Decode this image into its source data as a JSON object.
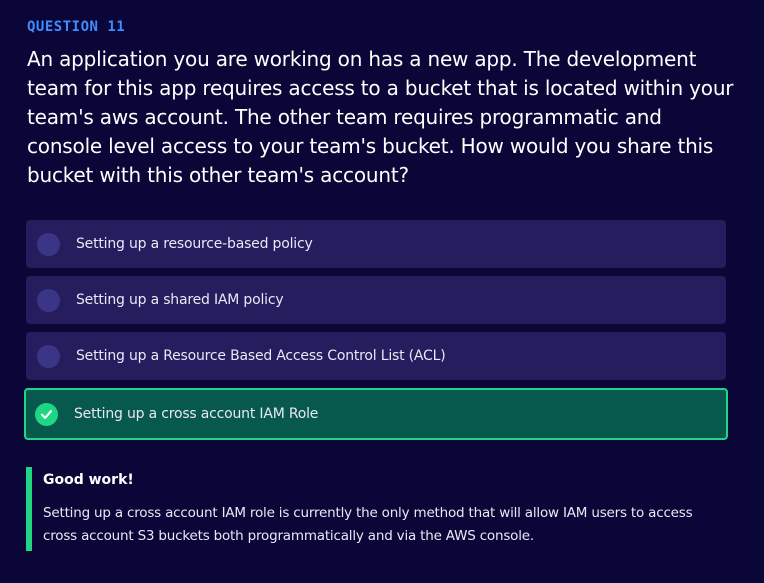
{
  "question": {
    "label": "QUESTION 11",
    "text": "An application you are working on has a new app. The development team for this app requires access to a bucket that is located within your team's aws account. The other team requires programmatic and console level access to your team's bucket. How would you share this bucket with this other team's account?"
  },
  "options": [
    {
      "label": "Setting up a resource-based policy",
      "selected": false
    },
    {
      "label": "Setting up a shared IAM policy",
      "selected": false
    },
    {
      "label": "Setting up a Resource Based Access Control List (ACL)",
      "selected": false
    },
    {
      "label": "Setting up a cross account IAM Role",
      "selected": true,
      "icon": "check-circle-icon"
    }
  ],
  "feedback": {
    "title": "Good work!",
    "text": "Setting up a cross account IAM role is currently the only method that will allow IAM users to access cross account S3 buckets both programmatically and via the AWS console."
  },
  "colors": {
    "background": "#0b0638",
    "accent_label": "#3f8cff",
    "option_bg": "#251d5e",
    "selected_bg": "#07594d",
    "success": "#1ed685"
  }
}
